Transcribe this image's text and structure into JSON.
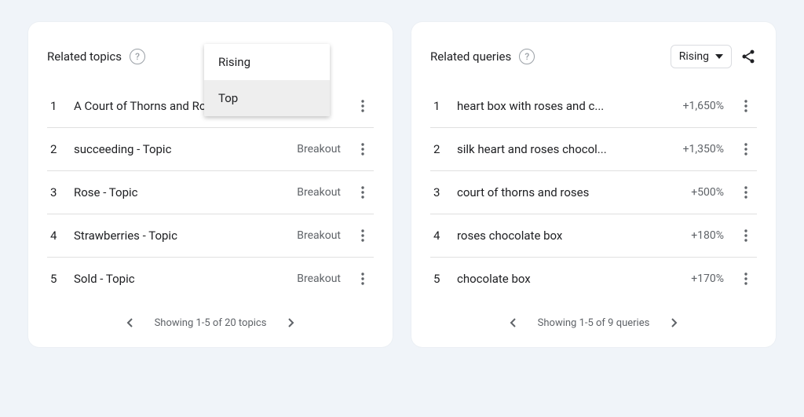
{
  "topics": {
    "title": "Related topics",
    "menu": {
      "option1": "Rising",
      "option2": "Top"
    },
    "items": [
      {
        "rank": "1",
        "label": "A Court of Thorns and Ros...",
        "metric": ""
      },
      {
        "rank": "2",
        "label": "succeeding - Topic",
        "metric": "Breakout"
      },
      {
        "rank": "3",
        "label": "Rose - Topic",
        "metric": "Breakout"
      },
      {
        "rank": "4",
        "label": "Strawberries - Topic",
        "metric": "Breakout"
      },
      {
        "rank": "5",
        "label": "Sold - Topic",
        "metric": "Breakout"
      }
    ],
    "pager": "Showing 1-5 of 20 topics"
  },
  "queries": {
    "title": "Related queries",
    "chip": "Rising",
    "items": [
      {
        "rank": "1",
        "label": "heart box with roses and c...",
        "metric": "+1,650%"
      },
      {
        "rank": "2",
        "label": "silk heart and roses chocol...",
        "metric": "+1,350%"
      },
      {
        "rank": "3",
        "label": "court of thorns and roses",
        "metric": "+500%"
      },
      {
        "rank": "4",
        "label": "roses chocolate box",
        "metric": "+180%"
      },
      {
        "rank": "5",
        "label": "chocolate box",
        "metric": "+170%"
      }
    ],
    "pager": "Showing 1-5 of 9 queries"
  }
}
